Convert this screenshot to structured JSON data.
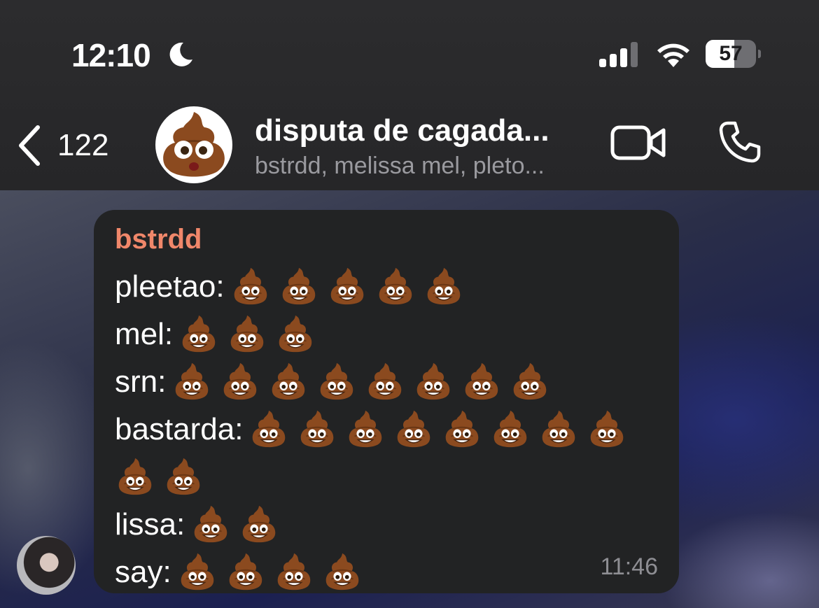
{
  "status_bar": {
    "time": "12:10",
    "battery": "57",
    "battery_level": 0.57
  },
  "header": {
    "back_count": "122",
    "group_name": "disputa de cagada...",
    "members": "bstrdd, melissa mel, pleto..."
  },
  "message": {
    "sender": "bstrdd",
    "sender_color": "#f0876a",
    "timestamp": "11:46",
    "emoji_icon": "pile-of-poo-emoji",
    "lines": [
      {
        "name": "pleetao:",
        "count": 5
      },
      {
        "name": "mel:",
        "count": 3
      },
      {
        "name": "srn:",
        "count": 8
      },
      {
        "name": "bastarda:",
        "count": 8
      },
      {
        "name": "",
        "count": 2
      },
      {
        "name": "lissa:",
        "count": 2
      },
      {
        "name": "say:",
        "count": 4
      }
    ]
  },
  "colors": {
    "header_bg": "#2c2c2e",
    "bubble_bg": "#222324",
    "poo_brown": "#8b4a1f"
  }
}
